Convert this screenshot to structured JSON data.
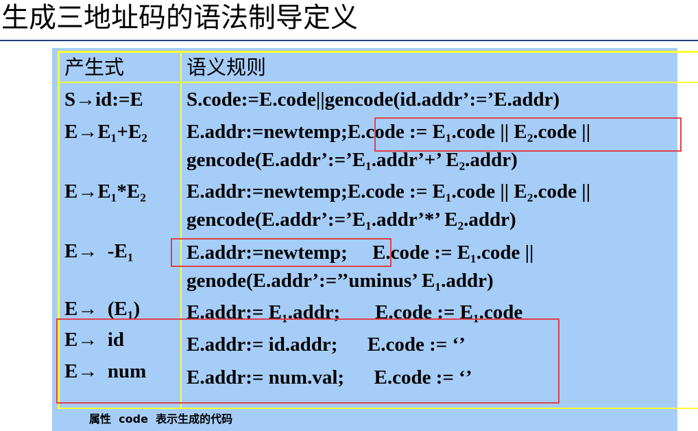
{
  "title": "生成三地址码的语法制导定义",
  "table": {
    "header": {
      "production": "产生式",
      "rule": "语义规则"
    },
    "rows": [
      {
        "production": "S→id:=E",
        "rule_lines": [
          "S.code:=E.code||gencode(id.addr’:=’E.addr)"
        ]
      },
      {
        "production": "E→E₁+E₂",
        "rule_lines": [
          "E.addr:=newtemp;E.code := E₁.code || E₂.code ||",
          "gencode(E.addr’:=’E₁.addr’+’ E₂.addr)"
        ]
      },
      {
        "production": "E→E₁*E₂",
        "rule_lines": [
          "E.addr:=newtemp;E.code := E₁.code || E₂.code ||",
          "gencode(E.addr’:=’E₁.addr’*’ E₂.addr)"
        ]
      },
      {
        "production": "E→  -E₁",
        "rule_lines": [
          "E.addr:=newtemp;     E.code := E₁.code ||",
          "genode(E.addr’:=’’uminus’ E₁.addr)"
        ]
      },
      {
        "production": "E→  (E₁)",
        "rule_lines": [
          "E.addr:= E₁.addr;       E.code := E₁.code"
        ]
      },
      {
        "production": "E→  id",
        "rule_lines": [
          "E.addr:= id.addr;      E.code := ‘’"
        ]
      },
      {
        "production": "E→  num",
        "rule_lines": [
          "E.addr:= num.val;      E.code := ‘’"
        ]
      }
    ]
  },
  "caption": "属性  code  表示生成的代码",
  "colors": {
    "panel": "#a6cdf7",
    "grid": "#ffff33",
    "highlight": "#e0404a",
    "rule": "#1f3f7a"
  }
}
